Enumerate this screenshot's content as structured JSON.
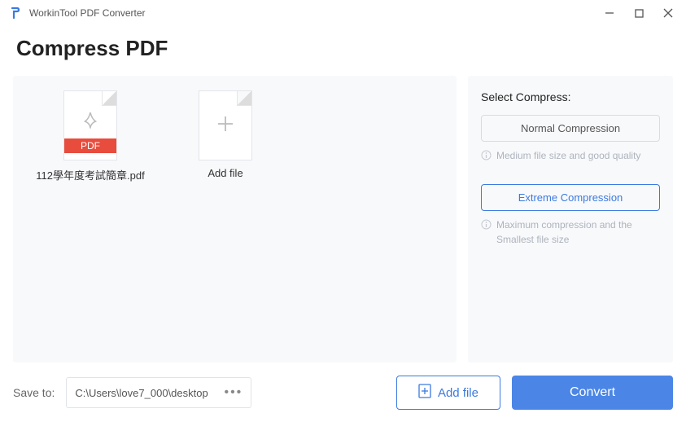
{
  "app": {
    "title": "WorkinTool PDF Converter"
  },
  "page": {
    "title": "Compress PDF"
  },
  "files": {
    "item0_name": "112學年度考試簡章.pdf",
    "pdf_band": "PDF",
    "add_tile_label": "Add file"
  },
  "side": {
    "heading": "Select Compress:",
    "normal_label": "Normal Compression",
    "normal_help": "Medium file size and good quality",
    "extreme_label": "Extreme Compression",
    "extreme_help": "Maximum compression and the Smallest file size"
  },
  "bottom": {
    "save_label": "Save to:",
    "path_value": "C:\\Users\\love7_000\\desktop",
    "more_label": "•••",
    "add_file_label": "Add file",
    "convert_label": "Convert"
  }
}
